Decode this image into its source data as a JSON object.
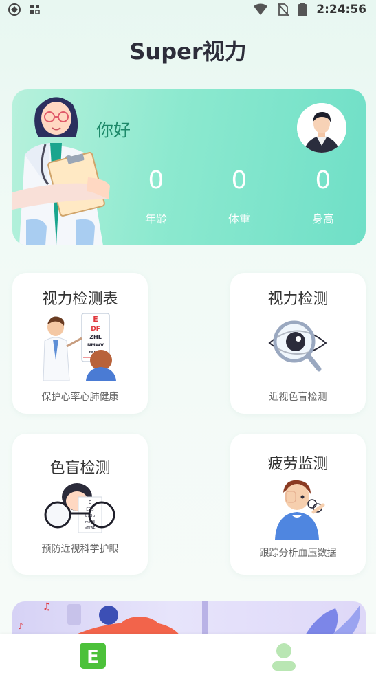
{
  "status_bar": {
    "time": "2:24:56",
    "icons": [
      "app-icon",
      "grid-icon",
      "wifi-icon",
      "no-sim-icon",
      "battery-icon"
    ]
  },
  "header": {
    "title": "Super视力"
  },
  "profile": {
    "greeting": "你好",
    "stats": [
      {
        "value": "0",
        "label": "年龄"
      },
      {
        "value": "0",
        "label": "体重"
      },
      {
        "value": "0",
        "label": "身高"
      }
    ],
    "colors": {
      "gradient_start": "#b7f1dc",
      "gradient_end": "#6fdfc7",
      "greeting": "#1e8a6a"
    }
  },
  "features": [
    {
      "title": "视力检测表",
      "subtitle": "保护心率心肺健康",
      "icon": "eye-chart-doctor-icon"
    },
    {
      "title": "视力检测",
      "subtitle": "近视色盲检测",
      "icon": "eye-magnifier-icon"
    },
    {
      "title": "色盲检测",
      "subtitle": "预防近视科学护眼",
      "icon": "glasses-chart-icon"
    },
    {
      "title": "疲劳监测",
      "subtitle": "跟踪分析血压数据",
      "icon": "tired-eye-icon"
    }
  ],
  "eye_chart_letters": {
    "rows": [
      "E",
      "DF",
      "ZHL",
      "NMWV",
      "EFHTA"
    ],
    "mini_rows": [
      "E",
      "E∃3",
      "E∃3u",
      "mE∃3",
      "∃mwE"
    ]
  },
  "bottom_nav": {
    "tabs": [
      {
        "label": "E",
        "icon": "e-chart-tab-icon",
        "active": true
      },
      {
        "label": "",
        "icon": "user-tab-icon",
        "active": false
      }
    ],
    "active_color": "#4cc13a",
    "inactive_color": "#b9e6b3"
  }
}
